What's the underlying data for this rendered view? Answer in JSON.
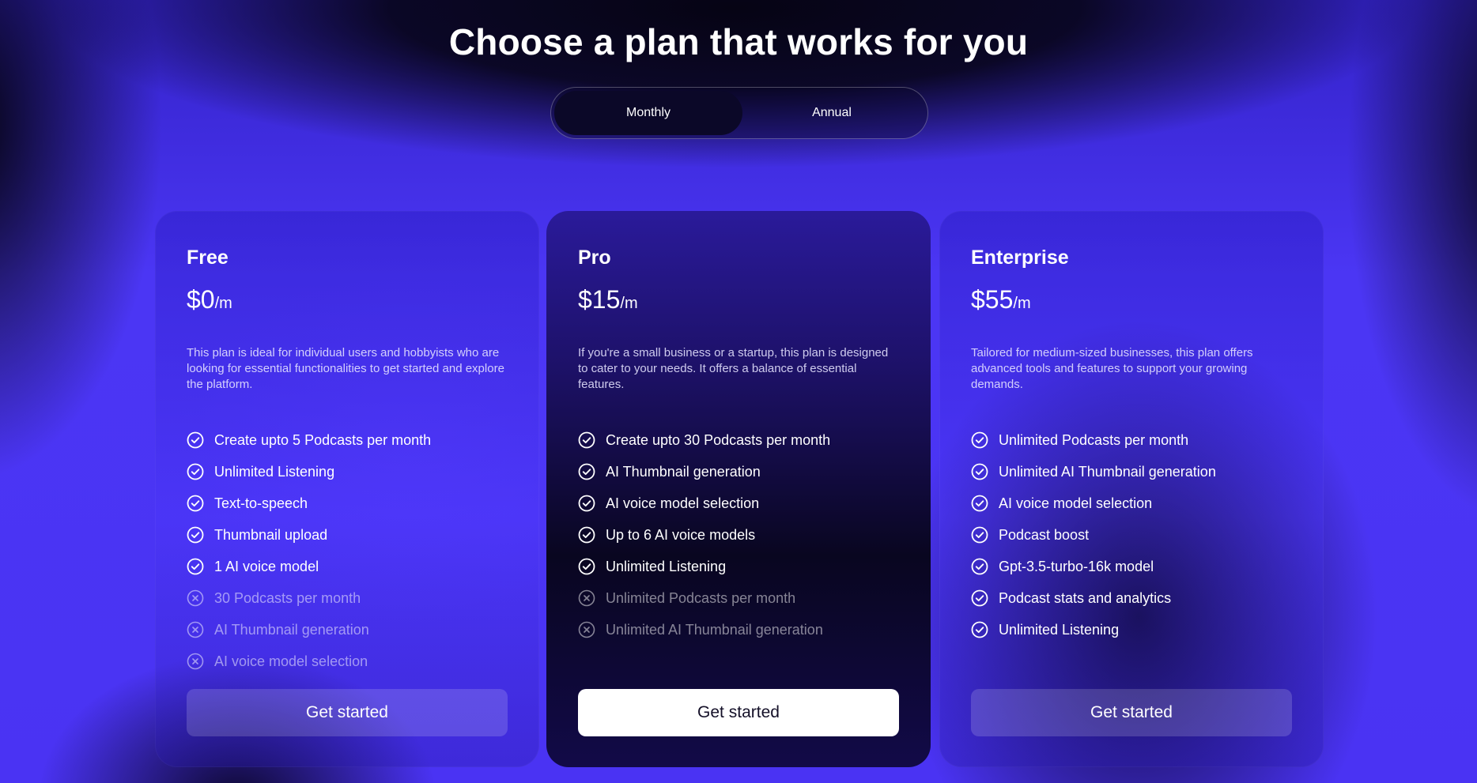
{
  "title": "Choose a plan that works for you",
  "billing_toggle": {
    "monthly_label": "Monthly",
    "annual_label": "Annual",
    "selected": "Monthly"
  },
  "colors": {
    "background_accent": "#4a33f3",
    "pro_card_dark": "#090620",
    "cta_solid": "#ffffff"
  },
  "plans": [
    {
      "name": "Free",
      "price": "$0",
      "unit": "/m",
      "description": "This plan is ideal for individual users and hobbyists who are looking for essential functionalities to get started and explore the platform.",
      "features": [
        {
          "label": "Create upto 5 Podcasts per month",
          "included": true
        },
        {
          "label": "Unlimited Listening",
          "included": true
        },
        {
          "label": "Text-to-speech",
          "included": true
        },
        {
          "label": "Thumbnail upload",
          "included": true
        },
        {
          "label": "1 AI voice model",
          "included": true
        },
        {
          "label": "30 Podcasts per month",
          "included": false
        },
        {
          "label": "AI Thumbnail generation",
          "included": false
        },
        {
          "label": "AI voice model selection",
          "included": false
        }
      ],
      "cta": "Get started"
    },
    {
      "name": "Pro",
      "price": "$15",
      "unit": "/m",
      "description": "If you're a small business or a startup, this plan is designed to cater to your needs. It offers a balance of essential features.",
      "features": [
        {
          "label": "Create upto 30 Podcasts per month",
          "included": true
        },
        {
          "label": "AI Thumbnail generation",
          "included": true
        },
        {
          "label": "AI voice model selection",
          "included": true
        },
        {
          "label": "Up to 6 AI voice models",
          "included": true
        },
        {
          "label": "Unlimited Listening",
          "included": true
        },
        {
          "label": "Unlimited Podcasts per month",
          "included": false
        },
        {
          "label": "Unlimited AI Thumbnail generation",
          "included": false
        }
      ],
      "cta": "Get started"
    },
    {
      "name": "Enterprise",
      "price": "$55",
      "unit": "/m",
      "description": "Tailored for medium-sized businesses, this plan offers advanced tools and features to support your growing demands.",
      "features": [
        {
          "label": "Unlimited Podcasts per month",
          "included": true
        },
        {
          "label": "Unlimited AI Thumbnail generation",
          "included": true
        },
        {
          "label": "AI voice model selection",
          "included": true
        },
        {
          "label": "Podcast boost",
          "included": true
        },
        {
          "label": "Gpt-3.5-turbo-16k model",
          "included": true
        },
        {
          "label": "Podcast stats and analytics",
          "included": true
        },
        {
          "label": "Unlimited Listening",
          "included": true
        }
      ],
      "cta": "Get started"
    }
  ]
}
